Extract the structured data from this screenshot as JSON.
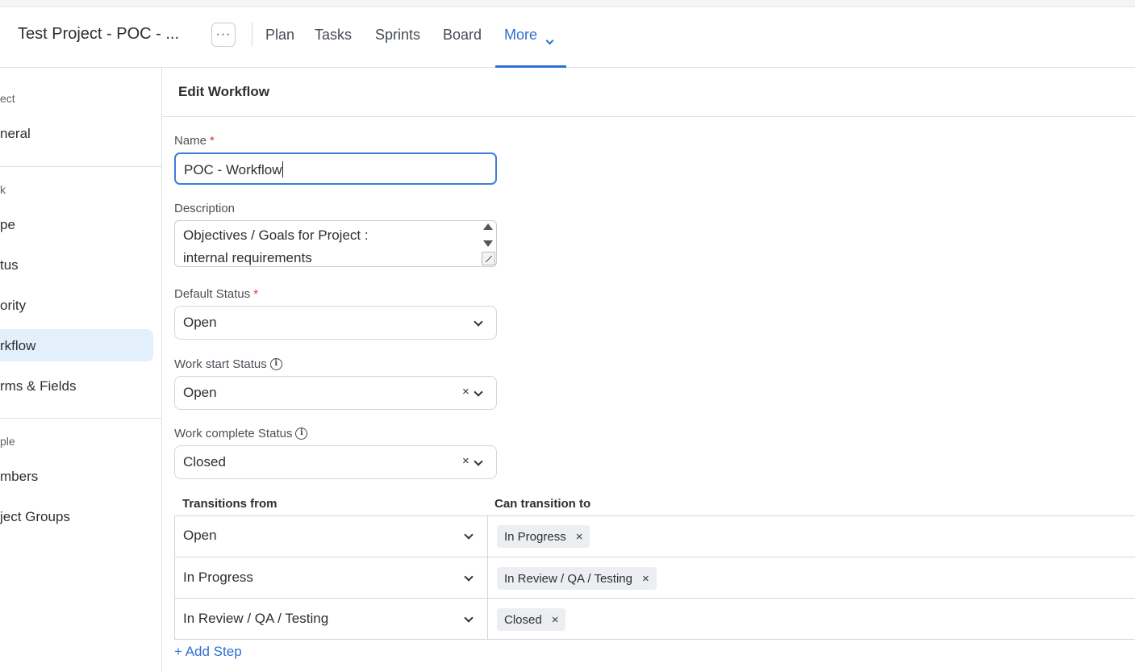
{
  "header": {
    "project_title": "Test Project - POC - ...",
    "more_menu_glyph": "···",
    "nav": [
      {
        "label": "Plan"
      },
      {
        "label": "Tasks"
      },
      {
        "label": "Sprints"
      },
      {
        "label": "Board"
      },
      {
        "label": "More"
      }
    ],
    "active_color": "#2f6fd1"
  },
  "sidebar": {
    "sections": [
      {
        "label": "ect",
        "items": [
          {
            "label": "neral"
          }
        ]
      },
      {
        "label": "k",
        "items": [
          {
            "label": "pe"
          },
          {
            "label": "tus"
          },
          {
            "label": "ority"
          },
          {
            "label": "rkflow"
          },
          {
            "label": "rms & Fields"
          }
        ]
      },
      {
        "label": "ple",
        "items": [
          {
            "label": "mbers"
          },
          {
            "label": "ject Groups"
          }
        ]
      }
    ],
    "selected_item": "rkflow",
    "selected_bg": "#e3f0fc"
  },
  "main": {
    "title": "Edit Workflow",
    "name": {
      "label": "Name",
      "required": "*",
      "value": "POC - Workflow"
    },
    "description": {
      "label": "Description",
      "lines": [
        "Objectives / Goals for Project :",
        "internal requirements"
      ]
    },
    "default_status": {
      "label": "Default Status",
      "required": "*",
      "value": "Open"
    },
    "work_start_status": {
      "label": "Work start Status",
      "info_glyph": "i",
      "value": "Open",
      "clear_glyph": "×"
    },
    "work_complete_status": {
      "label": "Work complete Status",
      "info_glyph": "i",
      "value": "Closed",
      "clear_glyph": "×"
    },
    "transitions": {
      "col_from": "Transitions from",
      "col_to": "Can transition to",
      "rows": [
        {
          "from": "Open",
          "to": "In Progress"
        },
        {
          "from": "In Progress",
          "to": "In Review / QA / Testing"
        },
        {
          "from": "In Review / QA / Testing",
          "to": "Closed"
        }
      ],
      "remove_glyph": "×"
    },
    "add_step": "+ Add Step"
  }
}
